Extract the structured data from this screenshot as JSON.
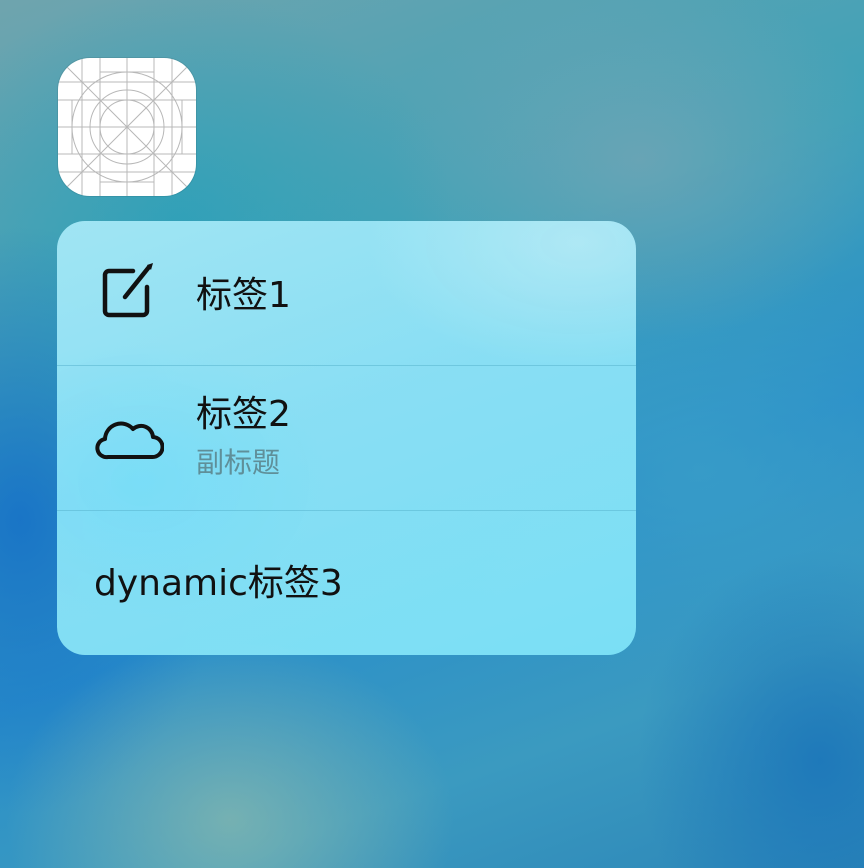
{
  "app_icon": {
    "icon": "app-icon-placeholder-grid"
  },
  "menu": {
    "items": [
      {
        "icon": "compose-icon",
        "title": "标签1"
      },
      {
        "icon": "cloud-icon",
        "title": "标签2",
        "subtitle": "副标题"
      },
      {
        "title": "dynamic标签3"
      }
    ]
  },
  "colors": {
    "menu_background": "#8fe3f5",
    "title_text": "#111111",
    "subtitle_text": "#5f8f99",
    "separator": "#5ab4cd"
  }
}
